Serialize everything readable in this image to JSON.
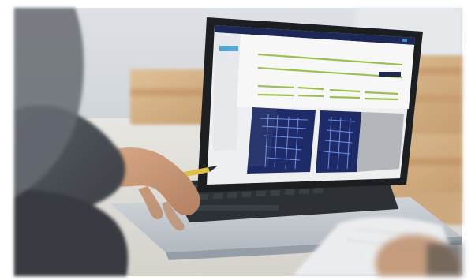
{
  "scene": {
    "description_label": "",
    "colors": {
      "frame_white": "#ffffff",
      "wall": "#d9dde0",
      "table": "#e9e6e1",
      "wood": "#d9b98f",
      "wood_dark": "#b68b5b",
      "laptop_silver": "#c9ced3",
      "laptop_dark": "#2b2f33",
      "screen_bg": "#f6f7f9",
      "screen_header": "#1e2a5a",
      "screen_accent": "#3fa1d8",
      "screen_green": "#9cc24a",
      "blueprint": "#1f2d6b",
      "blueprint_lines": "#7aa0ff",
      "skin": "#d2a17a",
      "shirt": "#4b4f55",
      "pencil_yellow": "#e6c64a",
      "paper": "#f3f4f6"
    }
  }
}
